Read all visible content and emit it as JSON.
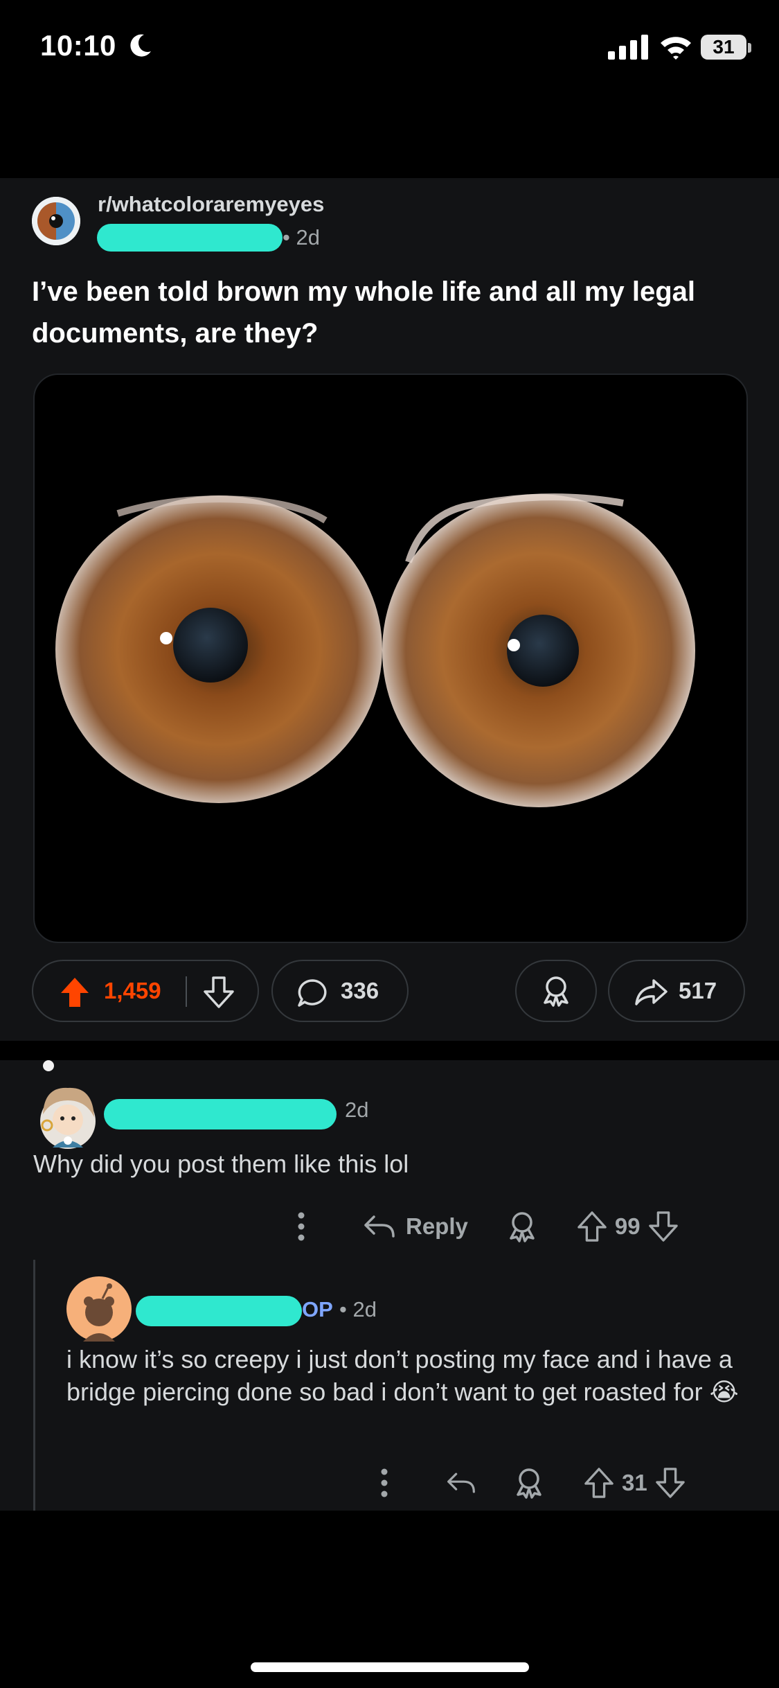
{
  "status_bar": {
    "time": "10:10",
    "battery": "31"
  },
  "post": {
    "subreddit": "r/whatcoloraremyeyes",
    "time": "• 2d",
    "title": "I’ve been told brown my whole life and all my legal documents, are they?",
    "upvotes": "1,459",
    "comments": "336",
    "shares": "517"
  },
  "comments": [
    {
      "time": "2d",
      "body": "Why did you post them like this lol",
      "reply_label": "Reply",
      "score": "99"
    },
    {
      "op_label": "OP",
      "time": "• 2d",
      "body": "i know it’s so creepy i just don’t posting my face and i have a bridge piercing done so bad i don’t want to get roasted for 😭",
      "score": "31"
    }
  ],
  "colors": {
    "accent": "#ff4500",
    "redaction": "#2fe8cf",
    "op": "#7fa6ff",
    "card": "#121315"
  }
}
